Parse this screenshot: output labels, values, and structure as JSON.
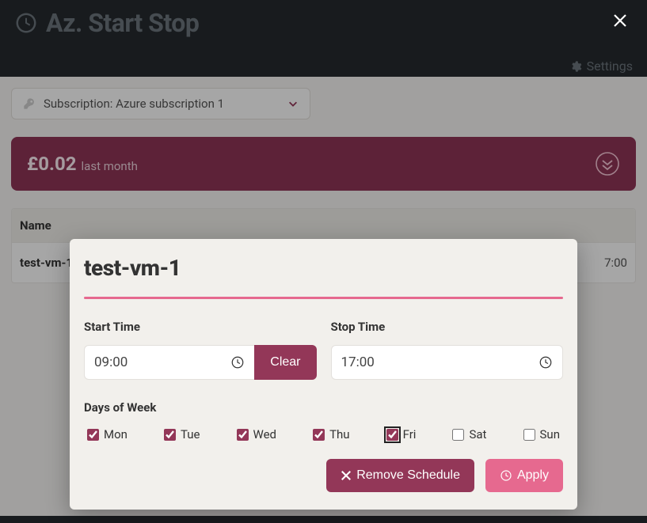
{
  "header": {
    "app_title": "Az. Start Stop",
    "settings_label": "Settings"
  },
  "subscription": {
    "label": "Subscription: Azure subscription 1"
  },
  "cost": {
    "amount": "£0.02",
    "period": "last month"
  },
  "table": {
    "columns": {
      "name": "Name"
    },
    "rows": [
      {
        "name": "test-vm-1",
        "time": "7:00"
      }
    ]
  },
  "modal": {
    "title": "test-vm-1",
    "start": {
      "label": "Start Time",
      "value": "09:00",
      "clear_label": "Clear"
    },
    "stop": {
      "label": "Stop Time",
      "value": "17:00"
    },
    "dow_label": "Days of Week",
    "days": [
      {
        "label": "Mon",
        "checked": true
      },
      {
        "label": "Tue",
        "checked": true
      },
      {
        "label": "Wed",
        "checked": true
      },
      {
        "label": "Thu",
        "checked": true
      },
      {
        "label": "Fri",
        "checked": true
      },
      {
        "label": "Sat",
        "checked": false
      },
      {
        "label": "Sun",
        "checked": false
      }
    ],
    "remove_label": "Remove Schedule",
    "apply_label": "Apply"
  }
}
